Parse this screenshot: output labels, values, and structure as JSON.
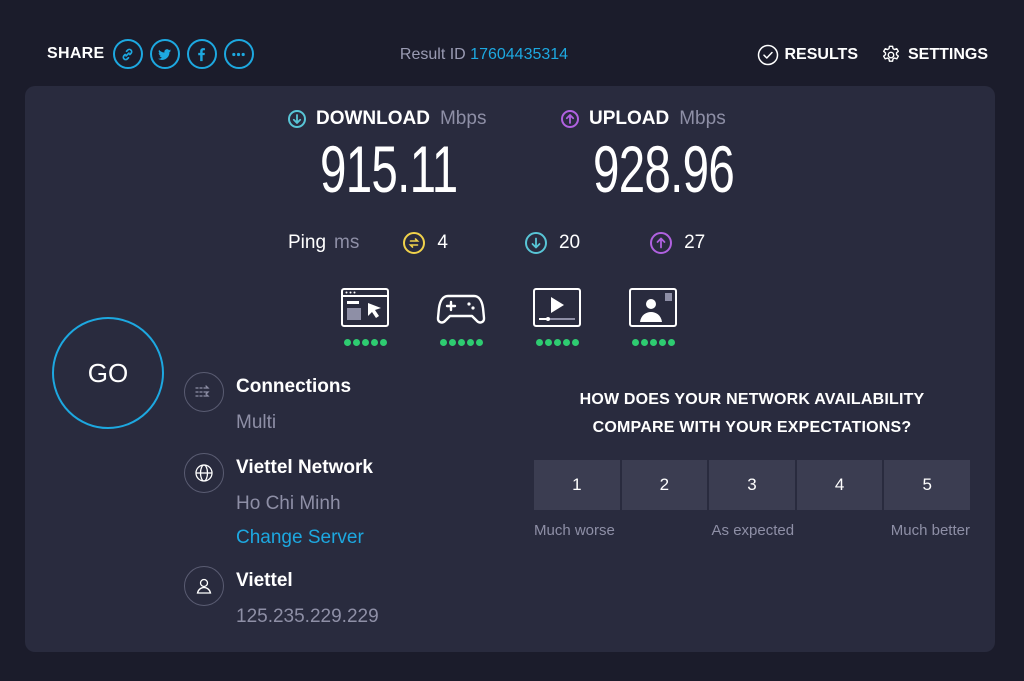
{
  "topbar": {
    "share_label": "SHARE",
    "share_buttons": [
      "link-icon",
      "twitter-icon",
      "facebook-icon",
      "more-icon"
    ],
    "result_id_label": "Result ID",
    "result_id_value": "17604435314",
    "results_label": "RESULTS",
    "settings_label": "SETTINGS"
  },
  "download": {
    "label": "DOWNLOAD",
    "unit": "Mbps",
    "value": "915.11",
    "color": "#58c5d6"
  },
  "upload": {
    "label": "UPLOAD",
    "unit": "Mbps",
    "value": "928.96",
    "color": "#b061e0"
  },
  "ping": {
    "label": "Ping",
    "unit": "ms",
    "idle": "4",
    "download": "20",
    "upload": "27",
    "idle_color": "#f0d24b",
    "download_color": "#58c5d6",
    "upload_color": "#b061e0"
  },
  "app_ratings": [
    {
      "icon": "web-browsing-icon",
      "dots": 5
    },
    {
      "icon": "gaming-icon",
      "dots": 5
    },
    {
      "icon": "video-streaming-icon",
      "dots": 5
    },
    {
      "icon": "video-call-icon",
      "dots": 5
    }
  ],
  "go_label": "GO",
  "connections": {
    "title": "Connections",
    "value": "Multi"
  },
  "server": {
    "title": "Viettel Network",
    "location": "Ho Chi Minh",
    "change_label": "Change Server"
  },
  "provider": {
    "title": "Viettel",
    "ip": "125.235.229.229"
  },
  "survey": {
    "question_line1": "HOW DOES YOUR NETWORK AVAILABILITY",
    "question_line2": "COMPARE WITH YOUR EXPECTATIONS?",
    "options": [
      "1",
      "2",
      "3",
      "4",
      "5"
    ],
    "label_low": "Much worse",
    "label_mid": "As expected",
    "label_high": "Much better"
  },
  "colors": {
    "accent": "#1da8e0",
    "good": "#2ecc71",
    "background": "#1b1c2b",
    "card": "#292b3e"
  }
}
